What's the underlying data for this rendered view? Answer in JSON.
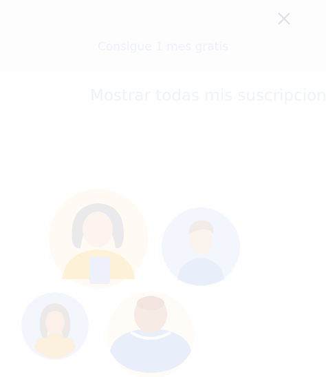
{
  "dialog": {
    "close_icon": "close-icon",
    "cta_label": "Consigue 1 mes gratis",
    "subscriptions_link": "Mostrar todas mis suscripciones",
    "illustration": {
      "icon": "family-avatars-illustration",
      "people": [
        "woman-avatar",
        "boy-avatar",
        "girl-avatar",
        "man-avatar"
      ]
    }
  },
  "colors": {
    "background": "#ffffff",
    "link_text": "#ecf1fb",
    "close_icon": "#dfe2e6"
  }
}
